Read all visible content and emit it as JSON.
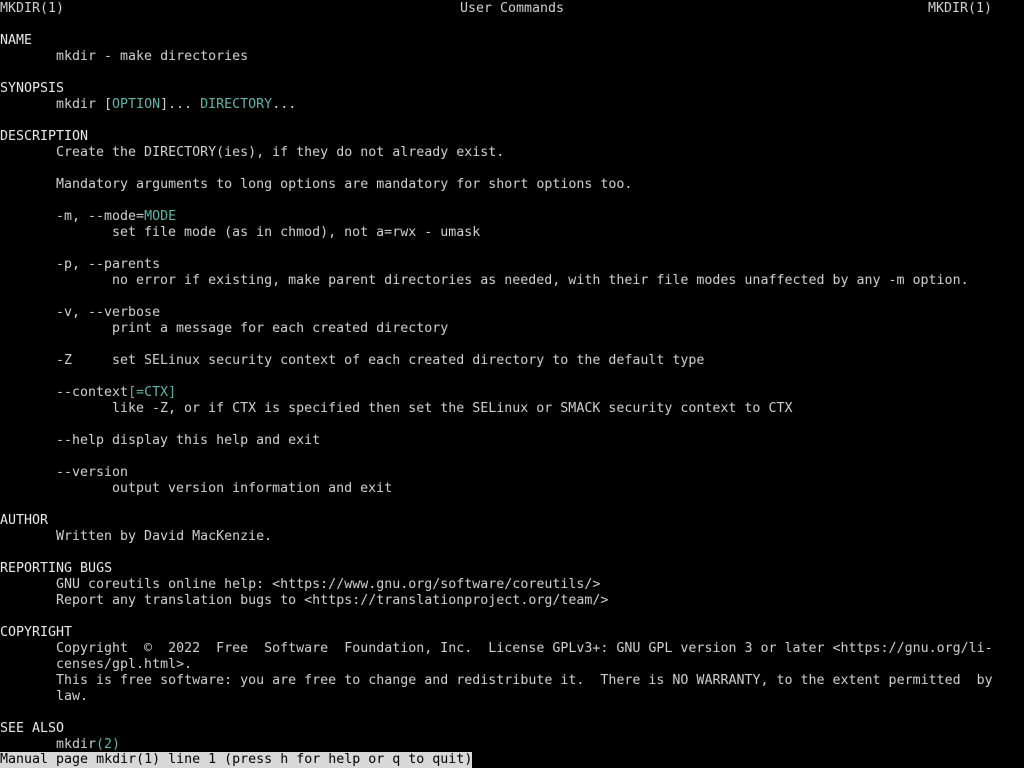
{
  "header": {
    "left": "MKDIR(1)",
    "center": "User Commands",
    "right": "MKDIR(1)"
  },
  "sections": {
    "name": {
      "heading": "NAME",
      "text": "mkdir - make directories"
    },
    "synopsis": {
      "heading": "SYNOPSIS",
      "cmd": "mkdir",
      "option": "OPTION",
      "directory": "DIRECTORY"
    },
    "description": {
      "heading": "DESCRIPTION",
      "line1": "Create the DIRECTORY(ies), if they do not already exist.",
      "line2": "Mandatory arguments to long options are mandatory for short options too.",
      "mode_flag": "-m, --mode=",
      "mode_arg": "MODE",
      "mode_desc": "set file mode (as in chmod), not a=rwx - umask",
      "parents_flag": "-p, --parents",
      "parents_desc": "no error if existing, make parent directories as needed, with their file modes unaffected by any -m option.",
      "verbose_flag": "-v, --verbose",
      "verbose_desc": "print a message for each created directory",
      "z_flag": "-Z",
      "z_desc": "set SELinux security context of each created directory to the default type",
      "context_flag": "--context",
      "context_arg": "[=CTX]",
      "context_desc": "like -Z, or if CTX is specified then set the SELinux or SMACK security context to CTX",
      "help_flag": "--help",
      "help_desc": "display this help and exit",
      "version_flag": "--version",
      "version_desc": "output version information and exit"
    },
    "author": {
      "heading": "AUTHOR",
      "text": "Written by David MacKenzie."
    },
    "bugs": {
      "heading": "REPORTING BUGS",
      "line1": "GNU coreutils online help: <https://www.gnu.org/software/coreutils/>",
      "line2": "Report any translation bugs to <https://translationproject.org/team/>"
    },
    "copyright": {
      "heading": "COPYRIGHT",
      "line1": "Copyright  ©  2022  Free  Software  Foundation, Inc.  License GPLv3+: GNU GPL version 3 or later <https://gnu.org/li-",
      "line2": "censes/gpl.html>.",
      "line3": "This is free software: you are free to change and redistribute it.  There is NO WARRANTY, to the extent permitted  by",
      "line4": "law."
    },
    "see_also": {
      "heading": "SEE ALSO",
      "cmd": "mkdir",
      "ref": "(2)"
    }
  },
  "status_bar": {
    "text": "Manual page mkdir(1) line 1 (press h for help or q to quit)"
  },
  "colors": {
    "background": "#000000",
    "text": "#d0d0d0",
    "highlight": "#5fb3a8",
    "status_bg": "#d8d8d8"
  }
}
